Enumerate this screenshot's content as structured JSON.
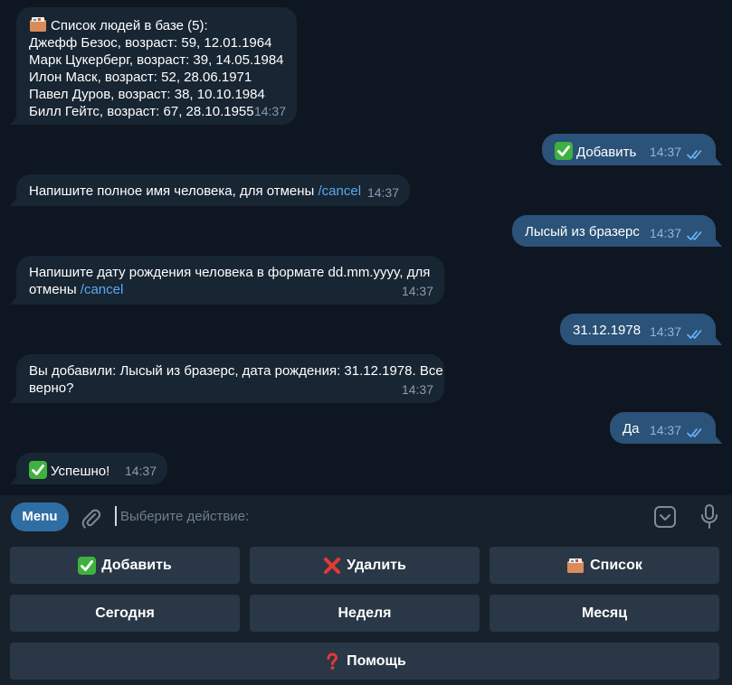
{
  "messages": [
    {
      "side": "in",
      "lines": [
        "Список людей в базе (5):",
        "Джефф Безос, возраст: 59, 12.01.1964",
        "Марк Цукерберг, возраст: 39, 14.05.1984",
        "Илон Маск, возраст: 52, 28.06.1971",
        "Павел Дуров, возраст: 38, 10.10.1984",
        "Билл Гейтс, возраст: 67, 28.10.1955"
      ],
      "time": "14:37"
    },
    {
      "side": "out",
      "text": "Добавить",
      "time": "14:37"
    },
    {
      "side": "in",
      "text": "Напишите полное имя человека, для отмены",
      "command": "/cancel",
      "time": "14:37"
    },
    {
      "side": "out",
      "text": "Лысый из бразерс",
      "time": "14:37"
    },
    {
      "side": "in",
      "line1": "Напишите дату рождения человека в формате dd.mm.yyyy, для",
      "line2": "отмены",
      "command": "/cancel",
      "time": "14:37"
    },
    {
      "side": "out",
      "text": "31.12.1978",
      "time": "14:37"
    },
    {
      "side": "in",
      "line1": "Вы добавили: Лысый из бразерс, дата рождения: 31.12.1978. Все",
      "line2": "верно?",
      "time": "14:37"
    },
    {
      "side": "out",
      "text": "Да",
      "time": "14:37"
    },
    {
      "side": "in",
      "text": "Успешно!",
      "time": "14:37"
    }
  ],
  "input": {
    "menu_label": "Menu",
    "placeholder": "Выберите действие:"
  },
  "keyboard": {
    "add": "Добавить",
    "delete": "Удалить",
    "list": "Список",
    "today": "Сегодня",
    "week": "Неделя",
    "month": "Месяц",
    "help": "Помощь"
  },
  "colors": {
    "background": "#0e1621",
    "incoming_bubble": "#182533",
    "outgoing_bubble": "#2b5278",
    "link": "#5aaaf0",
    "menu_button": "#2f6ea5",
    "keyboard_button": "#2a3746"
  },
  "icons": [
    "folder-icon",
    "check-mark-icon",
    "cross-icon",
    "question-icon",
    "double-check-icon",
    "paperclip-icon",
    "keyboard-icon",
    "microphone-icon"
  ]
}
